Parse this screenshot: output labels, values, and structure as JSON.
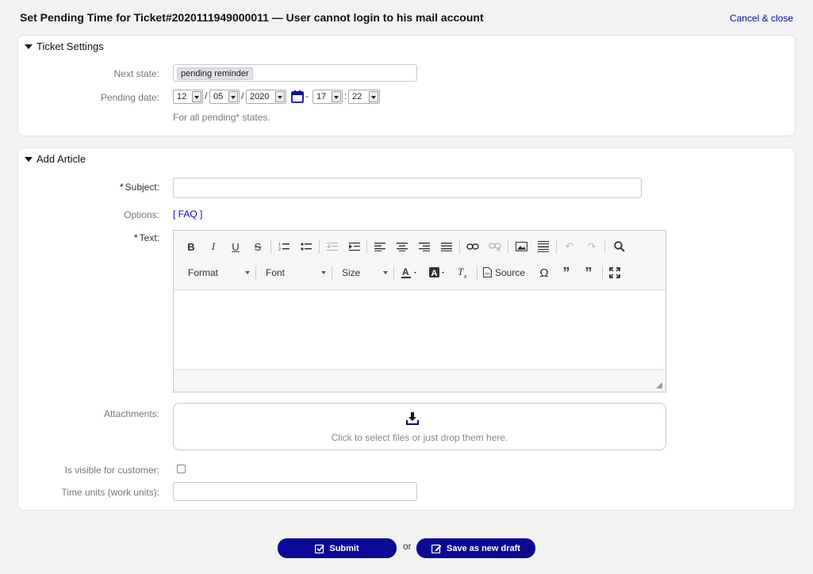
{
  "header": {
    "title": "Set Pending Time for Ticket#2020111949000011 — User cannot login to his mail account",
    "cancel_label": "Cancel & close"
  },
  "ticket_settings": {
    "title": "Ticket Settings",
    "next_state_label": "Next state:",
    "next_state_value": "pending reminder",
    "pending_date_label": "Pending date:",
    "month": "12",
    "day": "05",
    "year": "2020",
    "hour": "17",
    "minute": "22",
    "sep_slash": "/",
    "sep_dash": "-",
    "sep_colon": ":",
    "note": "For all pending* states."
  },
  "article": {
    "title": "Add Article",
    "required_mark": "*",
    "subject_label": "Subject:",
    "subject_value": "",
    "options_label": "Options:",
    "faq_link": "[ FAQ ]",
    "text_label": "Text:",
    "toolbar": {
      "format": "Format",
      "font": "Font",
      "size": "Size",
      "source": "Source"
    },
    "attachments_label": "Attachments:",
    "dropzone_text": "Click to select files or just drop them here.",
    "visible_label": "Is visible for customer:",
    "visible_checked": false,
    "time_units_label": "Time units (work units):",
    "time_units_value": ""
  },
  "footer": {
    "submit_label": "Submit",
    "or_text": "or",
    "draft_label": "Save as new draft"
  },
  "colors": {
    "accent": "#0a0a96",
    "link": "#0a0aa8"
  }
}
